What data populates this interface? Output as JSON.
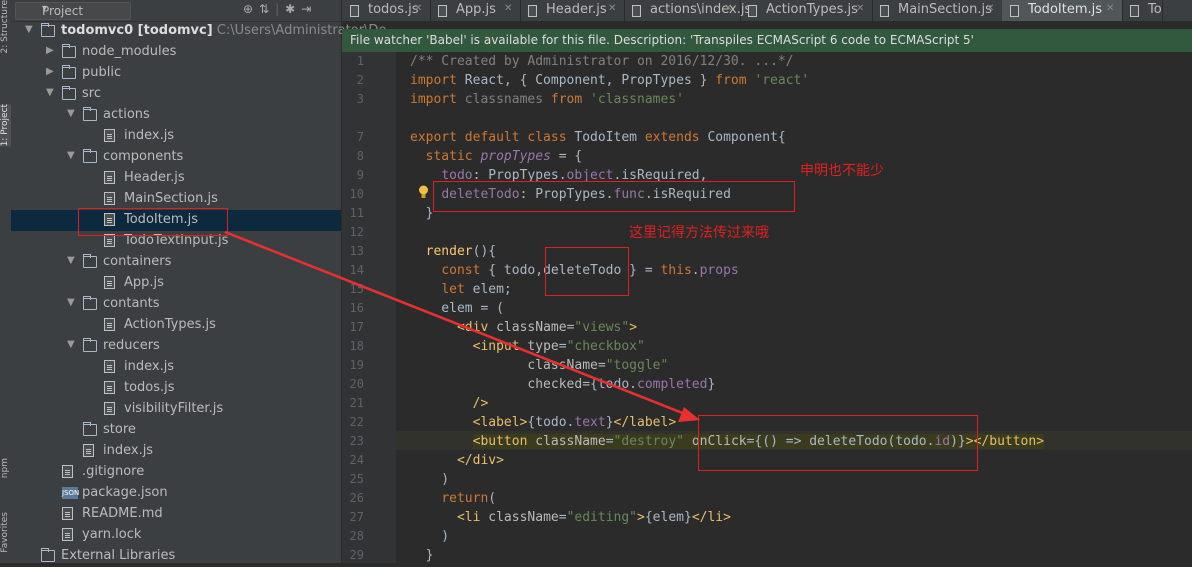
{
  "left_strip": {
    "top_label": "2: Structure",
    "mid_label": "1: Project",
    "bottom_label1": "npm",
    "bottom_label2": "Favorites"
  },
  "project_panel": {
    "view_selector": "Project",
    "tool_icons": [
      "globe-icon",
      "split-icon",
      "gear-icon",
      "hide-icon"
    ],
    "tree": [
      {
        "name": "todomvc0",
        "bold_suffix": "[todomvc]",
        "path": "C:\\Users\\Administrator\\De",
        "type": "folder",
        "expanded": true,
        "depth": 0
      },
      {
        "name": "node_modules",
        "type": "folder",
        "expanded": false,
        "depth": 1
      },
      {
        "name": "public",
        "type": "folder",
        "expanded": false,
        "depth": 1
      },
      {
        "name": "src",
        "type": "folder",
        "expanded": true,
        "depth": 1
      },
      {
        "name": "actions",
        "type": "folder",
        "expanded": true,
        "depth": 2
      },
      {
        "name": "index.js",
        "type": "file",
        "depth": 3
      },
      {
        "name": "components",
        "type": "folder",
        "expanded": true,
        "depth": 2
      },
      {
        "name": "Header.js",
        "type": "file",
        "depth": 3
      },
      {
        "name": "MainSection.js",
        "type": "file",
        "depth": 3
      },
      {
        "name": "TodoItem.js",
        "type": "file",
        "depth": 3,
        "selected": true
      },
      {
        "name": "TodoTextInput.js",
        "type": "file",
        "depth": 3
      },
      {
        "name": "containers",
        "type": "folder",
        "expanded": true,
        "depth": 2
      },
      {
        "name": "App.js",
        "type": "file",
        "depth": 3
      },
      {
        "name": "contants",
        "type": "folder",
        "expanded": true,
        "depth": 2
      },
      {
        "name": "ActionTypes.js",
        "type": "file",
        "depth": 3
      },
      {
        "name": "reducers",
        "type": "folder",
        "expanded": true,
        "depth": 2
      },
      {
        "name": "index.js",
        "type": "file",
        "depth": 3
      },
      {
        "name": "todos.js",
        "type": "file",
        "depth": 3
      },
      {
        "name": "visibilityFilter.js",
        "type": "file",
        "depth": 3
      },
      {
        "name": "store",
        "type": "folder",
        "expanded": false,
        "depth": 2,
        "no_arrow": true
      },
      {
        "name": "index.js",
        "type": "file",
        "depth": 2
      },
      {
        "name": ".gitignore",
        "type": "file",
        "depth": 1
      },
      {
        "name": "package.json",
        "type": "json",
        "depth": 1
      },
      {
        "name": "README.md",
        "type": "file",
        "depth": 1
      },
      {
        "name": "yarn.lock",
        "type": "file",
        "depth": 1
      },
      {
        "name": "External Libraries",
        "type": "lib",
        "depth": 0
      }
    ]
  },
  "tabs": [
    {
      "label": "todos.js",
      "active": false
    },
    {
      "label": "App.js",
      "active": false
    },
    {
      "label": "Header.js",
      "active": false
    },
    {
      "label": "actions\\index.js",
      "active": false
    },
    {
      "label": "ActionTypes.js",
      "active": false
    },
    {
      "label": "MainSection.js",
      "active": false
    },
    {
      "label": "TodoItem.js",
      "active": true
    },
    {
      "label": "To",
      "active": false
    }
  ],
  "banner": "File watcher 'Babel' is available for this file. Description: 'Transpiles ECMAScript 6 code to ECMAScript 5'",
  "line_numbers": [
    "1",
    "2",
    "3",
    "",
    "7",
    "8",
    "9",
    "10",
    "11",
    "12",
    "13",
    "14",
    "15",
    "16",
    "17",
    "18",
    "19",
    "20",
    "21",
    "22",
    "23",
    "24",
    "25",
    "26",
    "27",
    "28",
    "29"
  ],
  "annotations": {
    "note1": "申明也不能少",
    "note2": "这里记得方法传过来哦"
  },
  "colors": {
    "keyword": "#cc7832",
    "string": "#6a8759",
    "comment": "#808080",
    "annotation_red": "#e02020",
    "banner_bg": "#32593d"
  }
}
